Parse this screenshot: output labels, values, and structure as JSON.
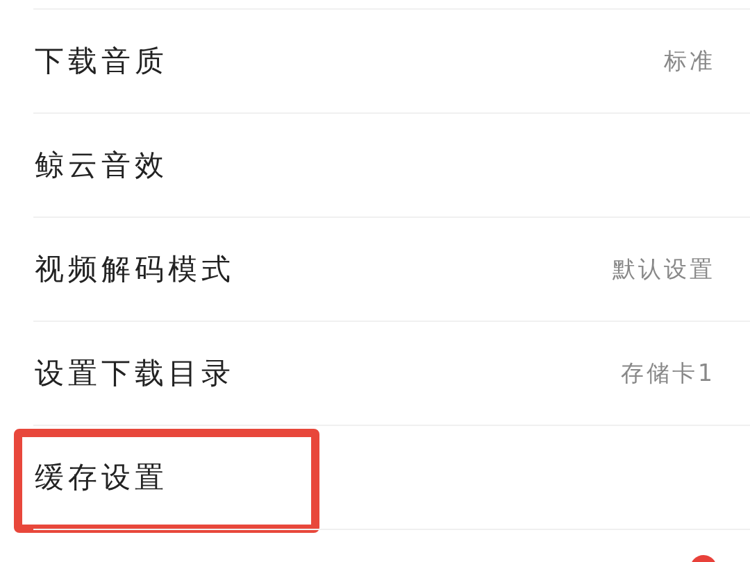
{
  "settings": [
    {
      "label": "下载音质",
      "value": "标准",
      "highlighted": false
    },
    {
      "label": "鲸云音效",
      "highlighted": false
    },
    {
      "label": "视频解码模式",
      "value": "默认设置",
      "highlighted": false
    },
    {
      "label": "设置下载目录",
      "value": "存储卡1",
      "highlighted": false
    },
    {
      "label": "缓存设置",
      "highlighted": true
    }
  ]
}
